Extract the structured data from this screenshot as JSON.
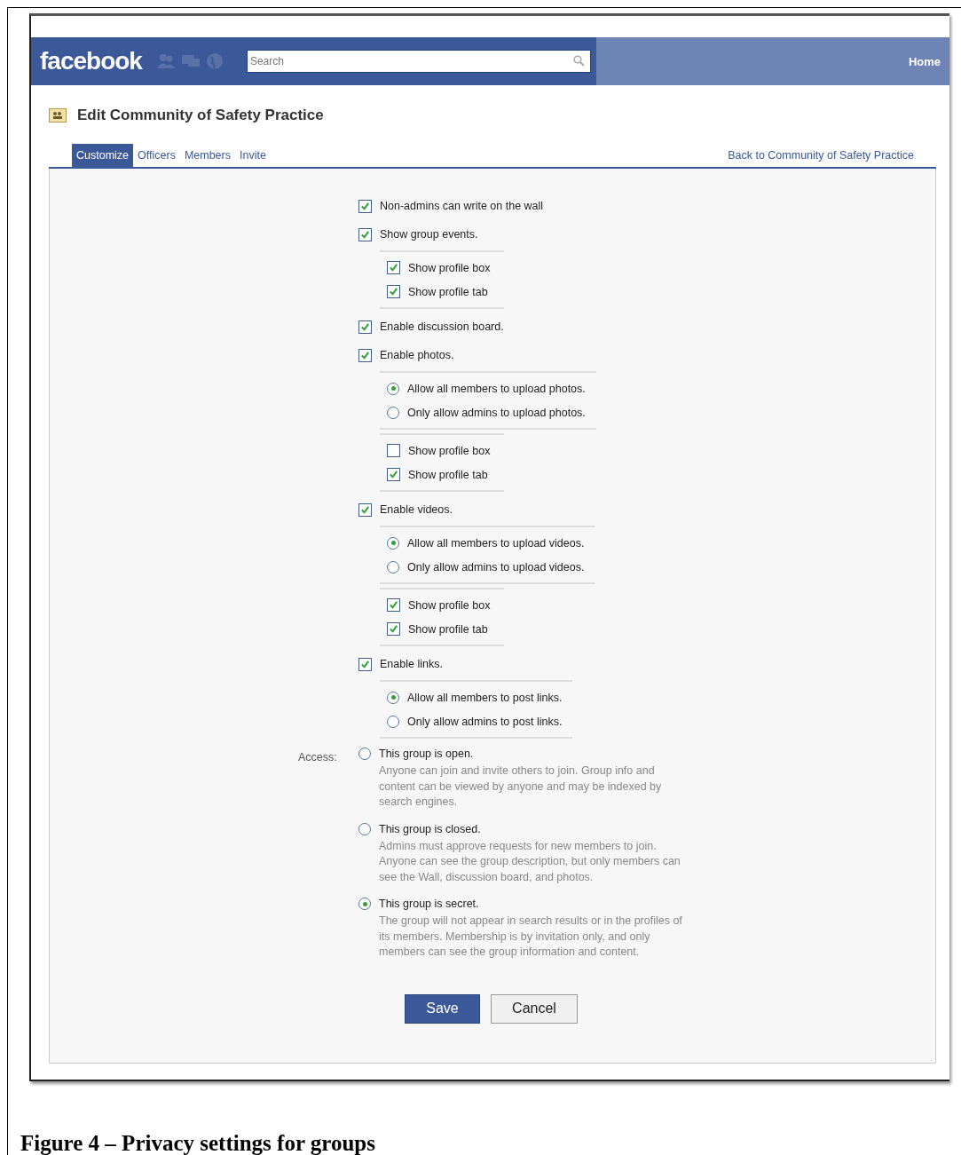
{
  "header": {
    "logo": "facebook",
    "search_placeholder": "Search",
    "nav": [
      "Home"
    ]
  },
  "page_title": "Edit Community of Safety Practice",
  "tabs": [
    {
      "label": "Customize",
      "selected": true
    },
    {
      "label": "Officers",
      "selected": false
    },
    {
      "label": "Members",
      "selected": false
    },
    {
      "label": "Invite",
      "selected": false
    }
  ],
  "back_link": "Back to Community of Safety Practice",
  "settings": [
    {
      "label": "Non-admins can write on the wall",
      "checked": true
    },
    {
      "label": "Show group events.",
      "checked": true,
      "groups": [
        [
          {
            "kind": "checkbox",
            "label": "Show profile box",
            "checked": true
          },
          {
            "kind": "checkbox",
            "label": "Show profile tab",
            "checked": true
          }
        ]
      ]
    },
    {
      "label": "Enable discussion board.",
      "checked": true
    },
    {
      "label": "Enable photos.",
      "checked": true,
      "groups": [
        [
          {
            "kind": "radio",
            "label": "Allow all members to upload photos.",
            "selected": true
          },
          {
            "kind": "radio",
            "label": "Only allow admins to upload photos.",
            "selected": false
          }
        ],
        [
          {
            "kind": "checkbox",
            "label": "Show profile box",
            "checked": false
          },
          {
            "kind": "checkbox",
            "label": "Show profile tab",
            "checked": true
          }
        ]
      ]
    },
    {
      "label": "Enable videos.",
      "checked": true,
      "groups": [
        [
          {
            "kind": "radio",
            "label": "Allow all members to upload videos.",
            "selected": true
          },
          {
            "kind": "radio",
            "label": "Only allow admins to upload videos.",
            "selected": false
          }
        ],
        [
          {
            "kind": "checkbox",
            "label": "Show profile box",
            "checked": true
          },
          {
            "kind": "checkbox",
            "label": "Show profile tab",
            "checked": true
          }
        ]
      ]
    },
    {
      "label": "Enable links.",
      "checked": true,
      "groups": [
        [
          {
            "kind": "radio",
            "label": "Allow all members to post links.",
            "selected": true
          },
          {
            "kind": "radio",
            "label": "Only allow admins to post links.",
            "selected": false
          }
        ]
      ]
    }
  ],
  "access": {
    "label": "Access:",
    "options": [
      {
        "title": "This group is open.",
        "description": "Anyone can join and invite others to join. Group info and content can be viewed by anyone and may be indexed by search engines.",
        "selected": false
      },
      {
        "title": "This group is closed.",
        "description": "Admins must approve requests for new members to join. Anyone can see the group description, but only members can see the Wall, discussion board, and photos.",
        "selected": false
      },
      {
        "title": "This group is secret.",
        "description": "The group will not appear in search results or in the profiles of its members. Membership is by invitation only, and only members can see the group information and content.",
        "selected": true
      }
    ]
  },
  "buttons": [
    {
      "kind": "primary",
      "label": "Save"
    },
    {
      "kind": "secondary",
      "label": "Cancel"
    }
  ],
  "caption": "Figure 4 – Privacy settings for groups"
}
